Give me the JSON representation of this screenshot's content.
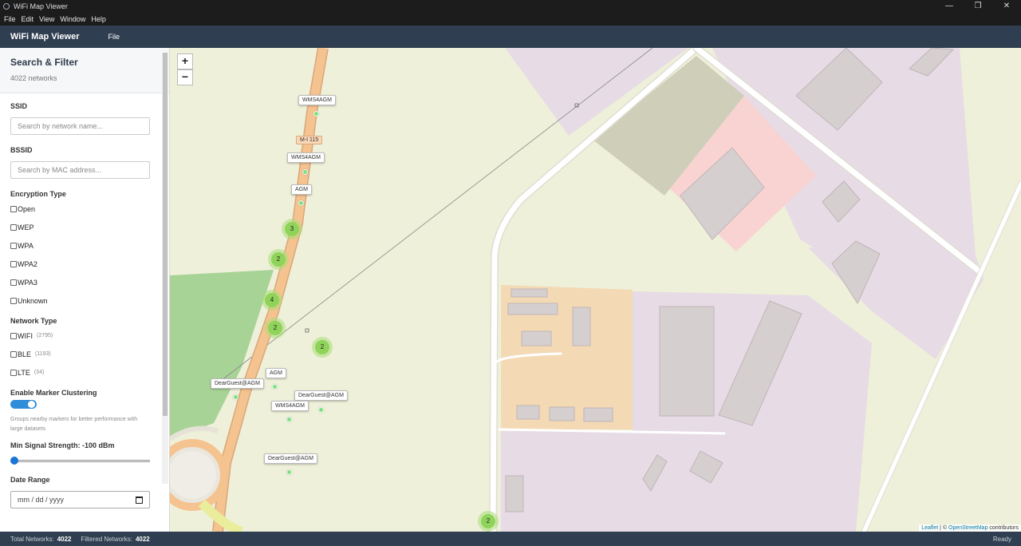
{
  "window": {
    "title": "WiFi Map Viewer",
    "controls": [
      "—",
      "❐",
      "✕"
    ]
  },
  "menubar": [
    "File",
    "Edit",
    "View",
    "Window",
    "Help"
  ],
  "header": {
    "brand": "WiFi Map Viewer",
    "file_menu": "File"
  },
  "sidebar": {
    "title": "Search & Filter",
    "count": "4022 networks",
    "ssid_label": "SSID",
    "ssid_placeholder": "Search by network name...",
    "bssid_label": "BSSID",
    "bssid_placeholder": "Search by MAC address...",
    "encryption_label": "Encryption Type",
    "encryption": [
      "Open",
      "WEP",
      "WPA",
      "WPA2",
      "WPA3",
      "Unknown"
    ],
    "network_type_label": "Network Type",
    "network_types": [
      {
        "label": "WIFI",
        "count": "(2795)"
      },
      {
        "label": "BLE",
        "count": "(1193)"
      },
      {
        "label": "LTE",
        "count": "(34)"
      }
    ],
    "clustering_label": "Enable Marker Clustering",
    "clustering_on": true,
    "clustering_help": "Groups nearby markers for better performance with large datasets",
    "signal_label": "Min Signal Strength: -100 dBm",
    "signal_level": 0,
    "date_label": "Date Range",
    "date_placeholder": "mm / dd / yyyy"
  },
  "map": {
    "zoom_in": "+",
    "zoom_out": "−",
    "road_label": "M-I 115",
    "labels": [
      "WMS4AGM",
      "WMS4AGM",
      "AGM",
      "AGM",
      "DearGuest@AGM",
      "DearGuest@AGM",
      "WMS4AGM",
      "DearGuest@AGM"
    ],
    "clusters": [
      "3",
      "2",
      "4",
      "2",
      "2",
      "2"
    ],
    "attribution": {
      "leaflet": "Leaflet",
      "sep": " | © ",
      "osm": "OpenStreetMap",
      "suffix": " contributors"
    }
  },
  "status": {
    "total_label": "Total Networks:",
    "total": "4022",
    "filtered_label": "Filtered Networks:",
    "filtered": "4022",
    "state": "Ready"
  },
  "colors": {
    "header_bg": "#2f3e50",
    "toggle_on": "#2f8dda",
    "cluster": "#8fd35a",
    "marker": "#7ce07c",
    "road": "#f5c38f"
  }
}
